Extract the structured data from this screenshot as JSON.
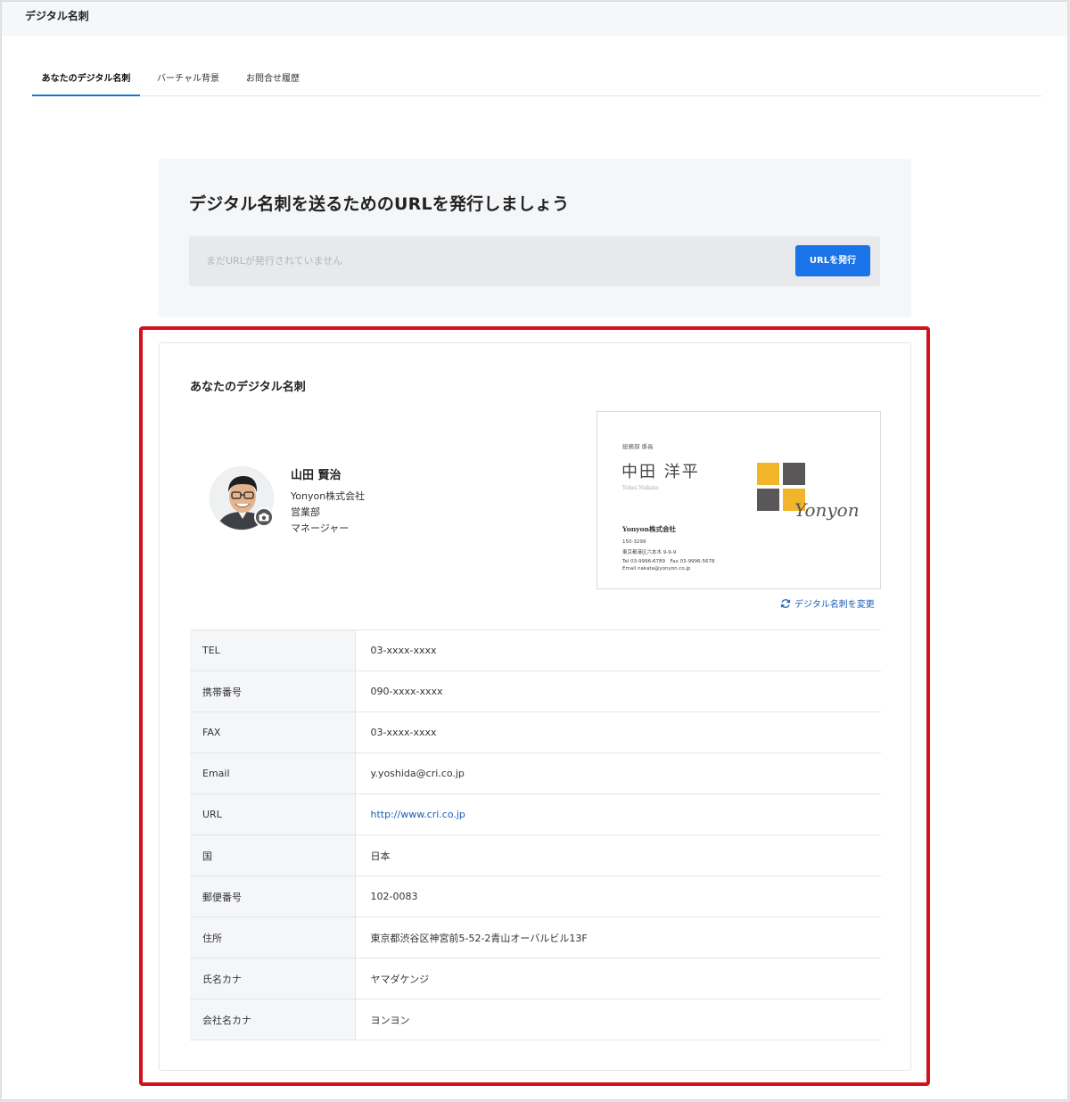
{
  "app": {
    "title": "デジタル名刺"
  },
  "tabs": [
    {
      "label": "あなたのデジタル名刺",
      "active": true
    },
    {
      "label": "バーチャル背景",
      "active": false
    },
    {
      "label": "お問合せ履歴",
      "active": false
    }
  ],
  "url_panel": {
    "heading": "デジタル名刺を送るためのURLを発行しましょう",
    "placeholder": "まだURLが発行されていません",
    "button_label": "URLを発行"
  },
  "card": {
    "title": "あなたのデジタル名刺",
    "profile": {
      "name": "山田 賢治",
      "company": "Yonyon株式会社",
      "department": "営業部",
      "position": "マネージャー"
    },
    "business_card": {
      "dept_title": "総務部 係長",
      "name": "中田 洋平",
      "name_roman": "Yohei Nakata",
      "company": "Yonyon株式会社",
      "postal": "150-3299",
      "address": "東京都港区六本木 9-9-9",
      "tel_fax": "Tel 03-9996-6789　Fax 03-9996-5678",
      "email": "Email nakata@yonyon.co.jp",
      "logo_text": "Yonyon",
      "logo_colors": {
        "yellow": "#f2b52a",
        "gray": "#595757"
      }
    },
    "change_link": "デジタル名刺を変更",
    "fields": [
      {
        "label": "TEL",
        "value": "03-xxxx-xxxx"
      },
      {
        "label": "携帯番号",
        "value": "090-xxxx-xxxx"
      },
      {
        "label": "FAX",
        "value": "03-xxxx-xxxx"
      },
      {
        "label": "Email",
        "value": "y.yoshida@cri.co.jp"
      },
      {
        "label": "URL",
        "value": "http://www.cri.co.jp"
      },
      {
        "label": "国",
        "value": "日本"
      },
      {
        "label": "郵便番号",
        "value": "102-0083"
      },
      {
        "label": "住所",
        "value": "東京都渋谷区神宮前5-52-2青山オーバルビル13F"
      },
      {
        "label": "氏名カナ",
        "value": "ヤマダケンジ"
      },
      {
        "label": "会社名カナ",
        "value": "ヨンヨン"
      }
    ]
  },
  "colors": {
    "accent": "#1a73e8",
    "highlight_frame": "#d2101e",
    "link": "#1a5fb4"
  }
}
